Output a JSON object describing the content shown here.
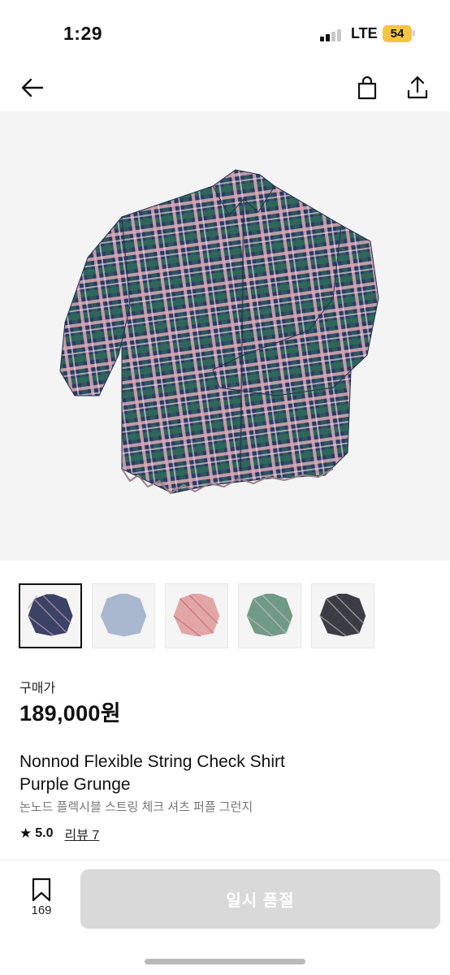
{
  "status_bar": {
    "time": "1:29",
    "network": "LTE",
    "battery": "54"
  },
  "nav": {
    "back_icon": "arrow-left-icon",
    "bag_icon": "shopping-bag-icon",
    "share_icon": "share-icon"
  },
  "product": {
    "price_label": "구매가",
    "price": "189,000원",
    "title_line1": "Nonnod Flexible String Check Shirt",
    "title_line2": "Purple Grunge",
    "subtitle": "논노드 플렉시블 스트링 체크 셔츠 퍼플 그런지",
    "rating": "5.0",
    "reviews": "리뷰 7",
    "thumbnail_colors": [
      "#3a4266",
      "#a9b7cf",
      "#e3a6a6",
      "#6f9a86",
      "#3c3c44"
    ]
  },
  "bottom": {
    "bookmark_count": "169",
    "cta_label": "일시 품절"
  },
  "colors": {
    "cta_bg": "#d9d9d9",
    "hero_bg": "#f4f4f4",
    "battery": "#f5c542"
  }
}
